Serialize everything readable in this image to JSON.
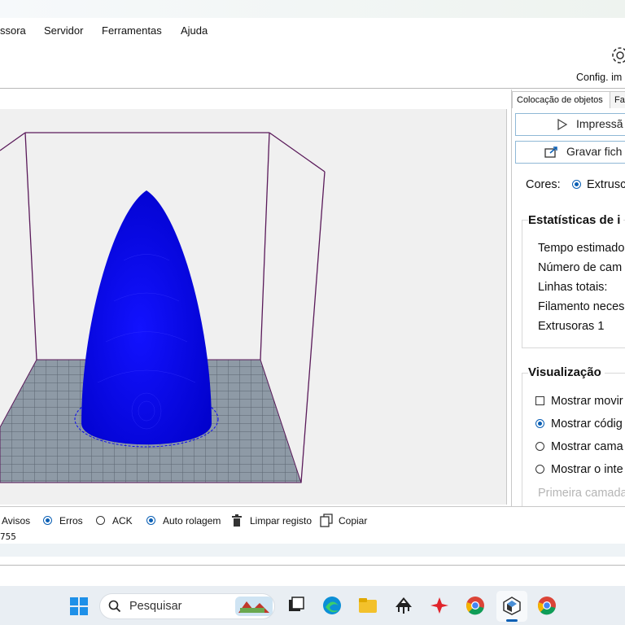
{
  "menu": {
    "items": [
      "ssora",
      "Servidor",
      "Ferramentas",
      "Ajuda"
    ]
  },
  "toolbar": {
    "config_label": "Config. im"
  },
  "tabs": [
    "Colocação de objetos",
    "Fa"
  ],
  "panel": {
    "print_button": "Impressã",
    "save_button": "Gravar fich",
    "colors_label": "Cores:",
    "colors_value": "Extrusc",
    "stats": {
      "title": "Estatísticas de i",
      "lines": [
        "Tempo estimado",
        "Número de cam",
        "Linhas totais:",
        "Filamento neces",
        "Extrusoras 1"
      ]
    },
    "view": {
      "title": "Visualização",
      "options": [
        "Mostrar movir",
        "Mostrar códig",
        "Mostrar cama",
        "Mostrar o inte"
      ],
      "faded": "Primeira camada"
    }
  },
  "log": {
    "avisos": "Avisos",
    "erros": "Erros",
    "ack": "ACK",
    "autoscroll": "Auto rolagem",
    "clear": "Limpar registo",
    "copy": "Copiar",
    "line": "755"
  },
  "taskbar": {
    "search_placeholder": "Pesquisar"
  },
  "colors": {
    "object": "#0a0af0",
    "bed": "#8e9aa6",
    "frame": "#5a1a5a",
    "accent": "#0a5fb4"
  }
}
